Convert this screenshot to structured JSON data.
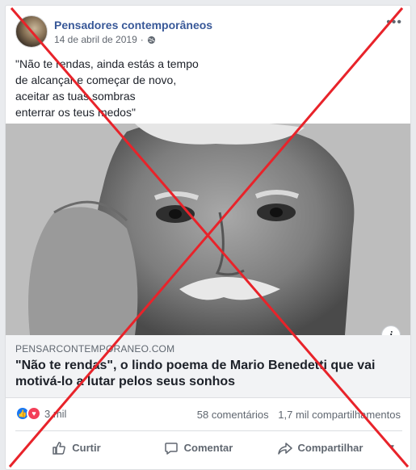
{
  "post": {
    "page_name": "Pensadores contemporâneos",
    "date": "14 de abril de 2019",
    "separator": "·",
    "privacy_icon": "globe-icon",
    "more_icon": "more-options-icon",
    "text_lines": [
      "\"Não te rendas, ainda estás a tempo",
      "de alcançar e começar de novo,",
      "aceitar as tuas sombras",
      "enterrar os teus medos\""
    ]
  },
  "link": {
    "domain": "PENSARCONTEMPORANEO.COM",
    "headline": "\"Não te rendas\", o lindo poema de Mario Benedetti que vai motivá-lo a lutar pelos seus sonhos",
    "info_label": "i"
  },
  "stats": {
    "reactions_count": "3 mil",
    "comments": "58 comentários",
    "shares": "1,7 mil compartilhamentos"
  },
  "actions": {
    "like": "Curtir",
    "comment": "Comentar",
    "share": "Compartilhar"
  },
  "overlay": {
    "cross_color": "#e8232a"
  },
  "colors": {
    "page_name": "#385898",
    "like_blue": "#1877f2",
    "love_red": "#f33e58"
  }
}
